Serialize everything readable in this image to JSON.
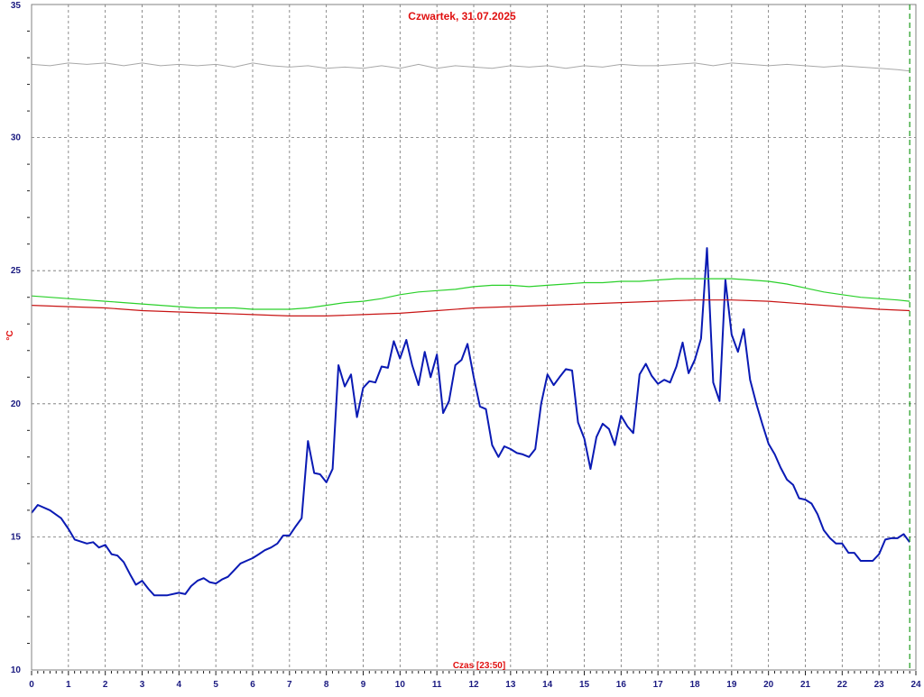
{
  "chart_data": {
    "type": "line",
    "title": "Czwartek, 31.07.2025",
    "xlabel": "Czas [23:50]",
    "ylabel": "°C",
    "xlim": [
      0,
      24
    ],
    "ylim": [
      10,
      35
    ],
    "x_ticks": [
      "0",
      "1",
      "2",
      "3",
      "4",
      "5",
      "6",
      "7",
      "8",
      "9",
      "10",
      "11",
      "12",
      "13",
      "14",
      "15",
      "16",
      "17",
      "18",
      "19",
      "20",
      "21",
      "22",
      "23",
      "24"
    ],
    "y_ticks": [
      "10",
      "15",
      "20",
      "25",
      "30",
      "35"
    ],
    "grid": true,
    "current_time_marker": 23.833,
    "colors": {
      "blue_series": "#0a1ab4",
      "green_series": "#2ad02a",
      "red_series": "#c81414",
      "gray_series": "#a8a8a8",
      "grid": "#707070",
      "marker": "#1a9a1a",
      "title": "#e01010",
      "ticks": "#1a1a80"
    },
    "series": [
      {
        "color": "#0a1ab4",
        "points": [
          [
            0,
            15.9
          ],
          [
            0.17,
            16.2
          ],
          [
            0.5,
            16.0
          ],
          [
            0.8,
            15.7
          ],
          [
            1.0,
            15.3
          ],
          [
            1.17,
            14.9
          ],
          [
            1.5,
            14.75
          ],
          [
            1.67,
            14.8
          ],
          [
            1.83,
            14.6
          ],
          [
            2.0,
            14.7
          ],
          [
            2.17,
            14.35
          ],
          [
            2.33,
            14.3
          ],
          [
            2.5,
            14.05
          ],
          [
            2.67,
            13.6
          ],
          [
            2.83,
            13.2
          ],
          [
            3.0,
            13.35
          ],
          [
            3.17,
            13.05
          ],
          [
            3.33,
            12.8
          ],
          [
            3.5,
            12.8
          ],
          [
            3.67,
            12.8
          ],
          [
            4.0,
            12.9
          ],
          [
            4.17,
            12.85
          ],
          [
            4.33,
            13.15
          ],
          [
            4.5,
            13.35
          ],
          [
            4.67,
            13.45
          ],
          [
            4.83,
            13.3
          ],
          [
            5.0,
            13.25
          ],
          [
            5.17,
            13.4
          ],
          [
            5.33,
            13.5
          ],
          [
            5.5,
            13.75
          ],
          [
            5.67,
            14.0
          ],
          [
            5.83,
            14.1
          ],
          [
            6.0,
            14.2
          ],
          [
            6.17,
            14.35
          ],
          [
            6.33,
            14.5
          ],
          [
            6.5,
            14.6
          ],
          [
            6.67,
            14.75
          ],
          [
            6.83,
            15.05
          ],
          [
            7.0,
            15.05
          ],
          [
            7.17,
            15.4
          ],
          [
            7.33,
            15.7
          ],
          [
            7.5,
            18.6
          ],
          [
            7.67,
            17.4
          ],
          [
            7.83,
            17.35
          ],
          [
            8.0,
            17.05
          ],
          [
            8.17,
            17.55
          ],
          [
            8.33,
            21.45
          ],
          [
            8.5,
            20.65
          ],
          [
            8.67,
            21.1
          ],
          [
            8.83,
            19.5
          ],
          [
            9.0,
            20.6
          ],
          [
            9.17,
            20.85
          ],
          [
            9.33,
            20.8
          ],
          [
            9.5,
            21.4
          ],
          [
            9.67,
            21.35
          ],
          [
            9.83,
            22.35
          ],
          [
            10.0,
            21.7
          ],
          [
            10.17,
            22.4
          ],
          [
            10.33,
            21.45
          ],
          [
            10.5,
            20.7
          ],
          [
            10.67,
            21.95
          ],
          [
            10.83,
            21.0
          ],
          [
            11.0,
            21.85
          ],
          [
            11.17,
            19.65
          ],
          [
            11.33,
            20.1
          ],
          [
            11.5,
            21.45
          ],
          [
            11.67,
            21.65
          ],
          [
            11.83,
            22.25
          ],
          [
            12.0,
            21.0
          ],
          [
            12.17,
            19.9
          ],
          [
            12.33,
            19.8
          ],
          [
            12.5,
            18.45
          ],
          [
            12.67,
            18.0
          ],
          [
            12.83,
            18.4
          ],
          [
            13.0,
            18.3
          ],
          [
            13.17,
            18.15
          ],
          [
            13.33,
            18.1
          ],
          [
            13.5,
            18.0
          ],
          [
            13.67,
            18.3
          ],
          [
            13.83,
            20.0
          ],
          [
            14.0,
            21.1
          ],
          [
            14.17,
            20.7
          ],
          [
            14.33,
            21.0
          ],
          [
            14.5,
            21.3
          ],
          [
            14.67,
            21.25
          ],
          [
            14.83,
            19.3
          ],
          [
            15.0,
            18.7
          ],
          [
            15.17,
            17.55
          ],
          [
            15.33,
            18.75
          ],
          [
            15.5,
            19.25
          ],
          [
            15.67,
            19.05
          ],
          [
            15.83,
            18.45
          ],
          [
            16.0,
            19.55
          ],
          [
            16.17,
            19.15
          ],
          [
            16.33,
            18.9
          ],
          [
            16.5,
            21.1
          ],
          [
            16.67,
            21.5
          ],
          [
            16.83,
            21.05
          ],
          [
            17.0,
            20.75
          ],
          [
            17.17,
            20.9
          ],
          [
            17.33,
            20.8
          ],
          [
            17.5,
            21.4
          ],
          [
            17.67,
            22.3
          ],
          [
            17.83,
            21.15
          ],
          [
            18.0,
            21.65
          ],
          [
            18.17,
            22.45
          ],
          [
            18.33,
            25.85
          ],
          [
            18.5,
            20.8
          ],
          [
            18.67,
            20.1
          ],
          [
            18.83,
            24.65
          ],
          [
            19.0,
            22.6
          ],
          [
            19.17,
            21.95
          ],
          [
            19.33,
            22.8
          ],
          [
            19.5,
            20.9
          ],
          [
            19.67,
            20.0
          ],
          [
            19.83,
            19.25
          ],
          [
            20.0,
            18.5
          ],
          [
            20.17,
            18.1
          ],
          [
            20.33,
            17.6
          ],
          [
            20.5,
            17.15
          ],
          [
            20.67,
            16.95
          ],
          [
            20.83,
            16.45
          ],
          [
            21.0,
            16.4
          ],
          [
            21.17,
            16.25
          ],
          [
            21.33,
            15.85
          ],
          [
            21.5,
            15.25
          ],
          [
            21.67,
            14.95
          ],
          [
            21.83,
            14.75
          ],
          [
            22.0,
            14.75
          ],
          [
            22.17,
            14.4
          ],
          [
            22.33,
            14.4
          ],
          [
            22.5,
            14.1
          ],
          [
            22.67,
            14.1
          ],
          [
            22.83,
            14.1
          ],
          [
            23.0,
            14.35
          ],
          [
            23.17,
            14.9
          ],
          [
            23.33,
            14.95
          ],
          [
            23.5,
            14.95
          ],
          [
            23.67,
            15.1
          ],
          [
            23.83,
            14.8
          ]
        ]
      },
      {
        "color": "#2ad02a",
        "points": [
          [
            0,
            24.05
          ],
          [
            0.5,
            24.0
          ],
          [
            1,
            23.95
          ],
          [
            1.5,
            23.9
          ],
          [
            2,
            23.85
          ],
          [
            2.5,
            23.8
          ],
          [
            3,
            23.75
          ],
          [
            3.5,
            23.7
          ],
          [
            4,
            23.65
          ],
          [
            4.5,
            23.6
          ],
          [
            5,
            23.6
          ],
          [
            5.5,
            23.6
          ],
          [
            6,
            23.55
          ],
          [
            6.5,
            23.55
          ],
          [
            7,
            23.55
          ],
          [
            7.5,
            23.6
          ],
          [
            8,
            23.7
          ],
          [
            8.5,
            23.8
          ],
          [
            9,
            23.85
          ],
          [
            9.5,
            23.95
          ],
          [
            10,
            24.1
          ],
          [
            10.5,
            24.2
          ],
          [
            11,
            24.25
          ],
          [
            11.5,
            24.3
          ],
          [
            12,
            24.4
          ],
          [
            12.5,
            24.45
          ],
          [
            13,
            24.45
          ],
          [
            13.5,
            24.4
          ],
          [
            14,
            24.45
          ],
          [
            14.5,
            24.5
          ],
          [
            15,
            24.55
          ],
          [
            15.5,
            24.55
          ],
          [
            16,
            24.6
          ],
          [
            16.5,
            24.6
          ],
          [
            17,
            24.65
          ],
          [
            17.5,
            24.7
          ],
          [
            18,
            24.7
          ],
          [
            18.5,
            24.7
          ],
          [
            19,
            24.7
          ],
          [
            19.5,
            24.65
          ],
          [
            20,
            24.6
          ],
          [
            20.5,
            24.5
          ],
          [
            21,
            24.35
          ],
          [
            21.5,
            24.2
          ],
          [
            22,
            24.1
          ],
          [
            22.5,
            24.0
          ],
          [
            23,
            23.95
          ],
          [
            23.5,
            23.9
          ],
          [
            23.83,
            23.85
          ]
        ]
      },
      {
        "color": "#c81414",
        "points": [
          [
            0,
            23.7
          ],
          [
            1,
            23.65
          ],
          [
            2,
            23.6
          ],
          [
            3,
            23.5
          ],
          [
            4,
            23.45
          ],
          [
            5,
            23.4
          ],
          [
            6,
            23.35
          ],
          [
            7,
            23.3
          ],
          [
            8,
            23.3
          ],
          [
            9,
            23.35
          ],
          [
            10,
            23.4
          ],
          [
            11,
            23.5
          ],
          [
            12,
            23.6
          ],
          [
            13,
            23.65
          ],
          [
            14,
            23.7
          ],
          [
            15,
            23.75
          ],
          [
            16,
            23.8
          ],
          [
            17,
            23.85
          ],
          [
            18,
            23.9
          ],
          [
            19,
            23.9
          ],
          [
            20,
            23.85
          ],
          [
            21,
            23.75
          ],
          [
            22,
            23.65
          ],
          [
            23,
            23.55
          ],
          [
            23.83,
            23.5
          ]
        ]
      },
      {
        "color": "#a8a8a8",
        "points": [
          [
            0,
            32.75
          ],
          [
            0.5,
            32.7
          ],
          [
            1,
            32.8
          ],
          [
            1.5,
            32.75
          ],
          [
            2,
            32.8
          ],
          [
            2.5,
            32.7
          ],
          [
            3,
            32.8
          ],
          [
            3.5,
            32.7
          ],
          [
            4,
            32.75
          ],
          [
            4.5,
            32.7
          ],
          [
            5,
            32.75
          ],
          [
            5.5,
            32.65
          ],
          [
            6,
            32.8
          ],
          [
            6.5,
            32.7
          ],
          [
            7,
            32.65
          ],
          [
            7.5,
            32.7
          ],
          [
            8,
            32.6
          ],
          [
            8.5,
            32.65
          ],
          [
            9,
            32.6
          ],
          [
            9.5,
            32.7
          ],
          [
            10,
            32.6
          ],
          [
            10.5,
            32.75
          ],
          [
            11,
            32.6
          ],
          [
            11.5,
            32.7
          ],
          [
            12,
            32.65
          ],
          [
            12.5,
            32.6
          ],
          [
            13,
            32.7
          ],
          [
            13.5,
            32.65
          ],
          [
            14,
            32.7
          ],
          [
            14.5,
            32.6
          ],
          [
            15,
            32.7
          ],
          [
            15.5,
            32.65
          ],
          [
            16,
            32.75
          ],
          [
            16.5,
            32.7
          ],
          [
            17,
            32.7
          ],
          [
            17.5,
            32.75
          ],
          [
            18,
            32.8
          ],
          [
            18.5,
            32.7
          ],
          [
            19,
            32.8
          ],
          [
            19.5,
            32.75
          ],
          [
            20,
            32.7
          ],
          [
            20.5,
            32.75
          ],
          [
            21,
            32.7
          ],
          [
            21.5,
            32.65
          ],
          [
            22,
            32.7
          ],
          [
            22.5,
            32.65
          ],
          [
            23,
            32.6
          ],
          [
            23.5,
            32.55
          ],
          [
            23.83,
            32.5
          ]
        ]
      }
    ]
  }
}
